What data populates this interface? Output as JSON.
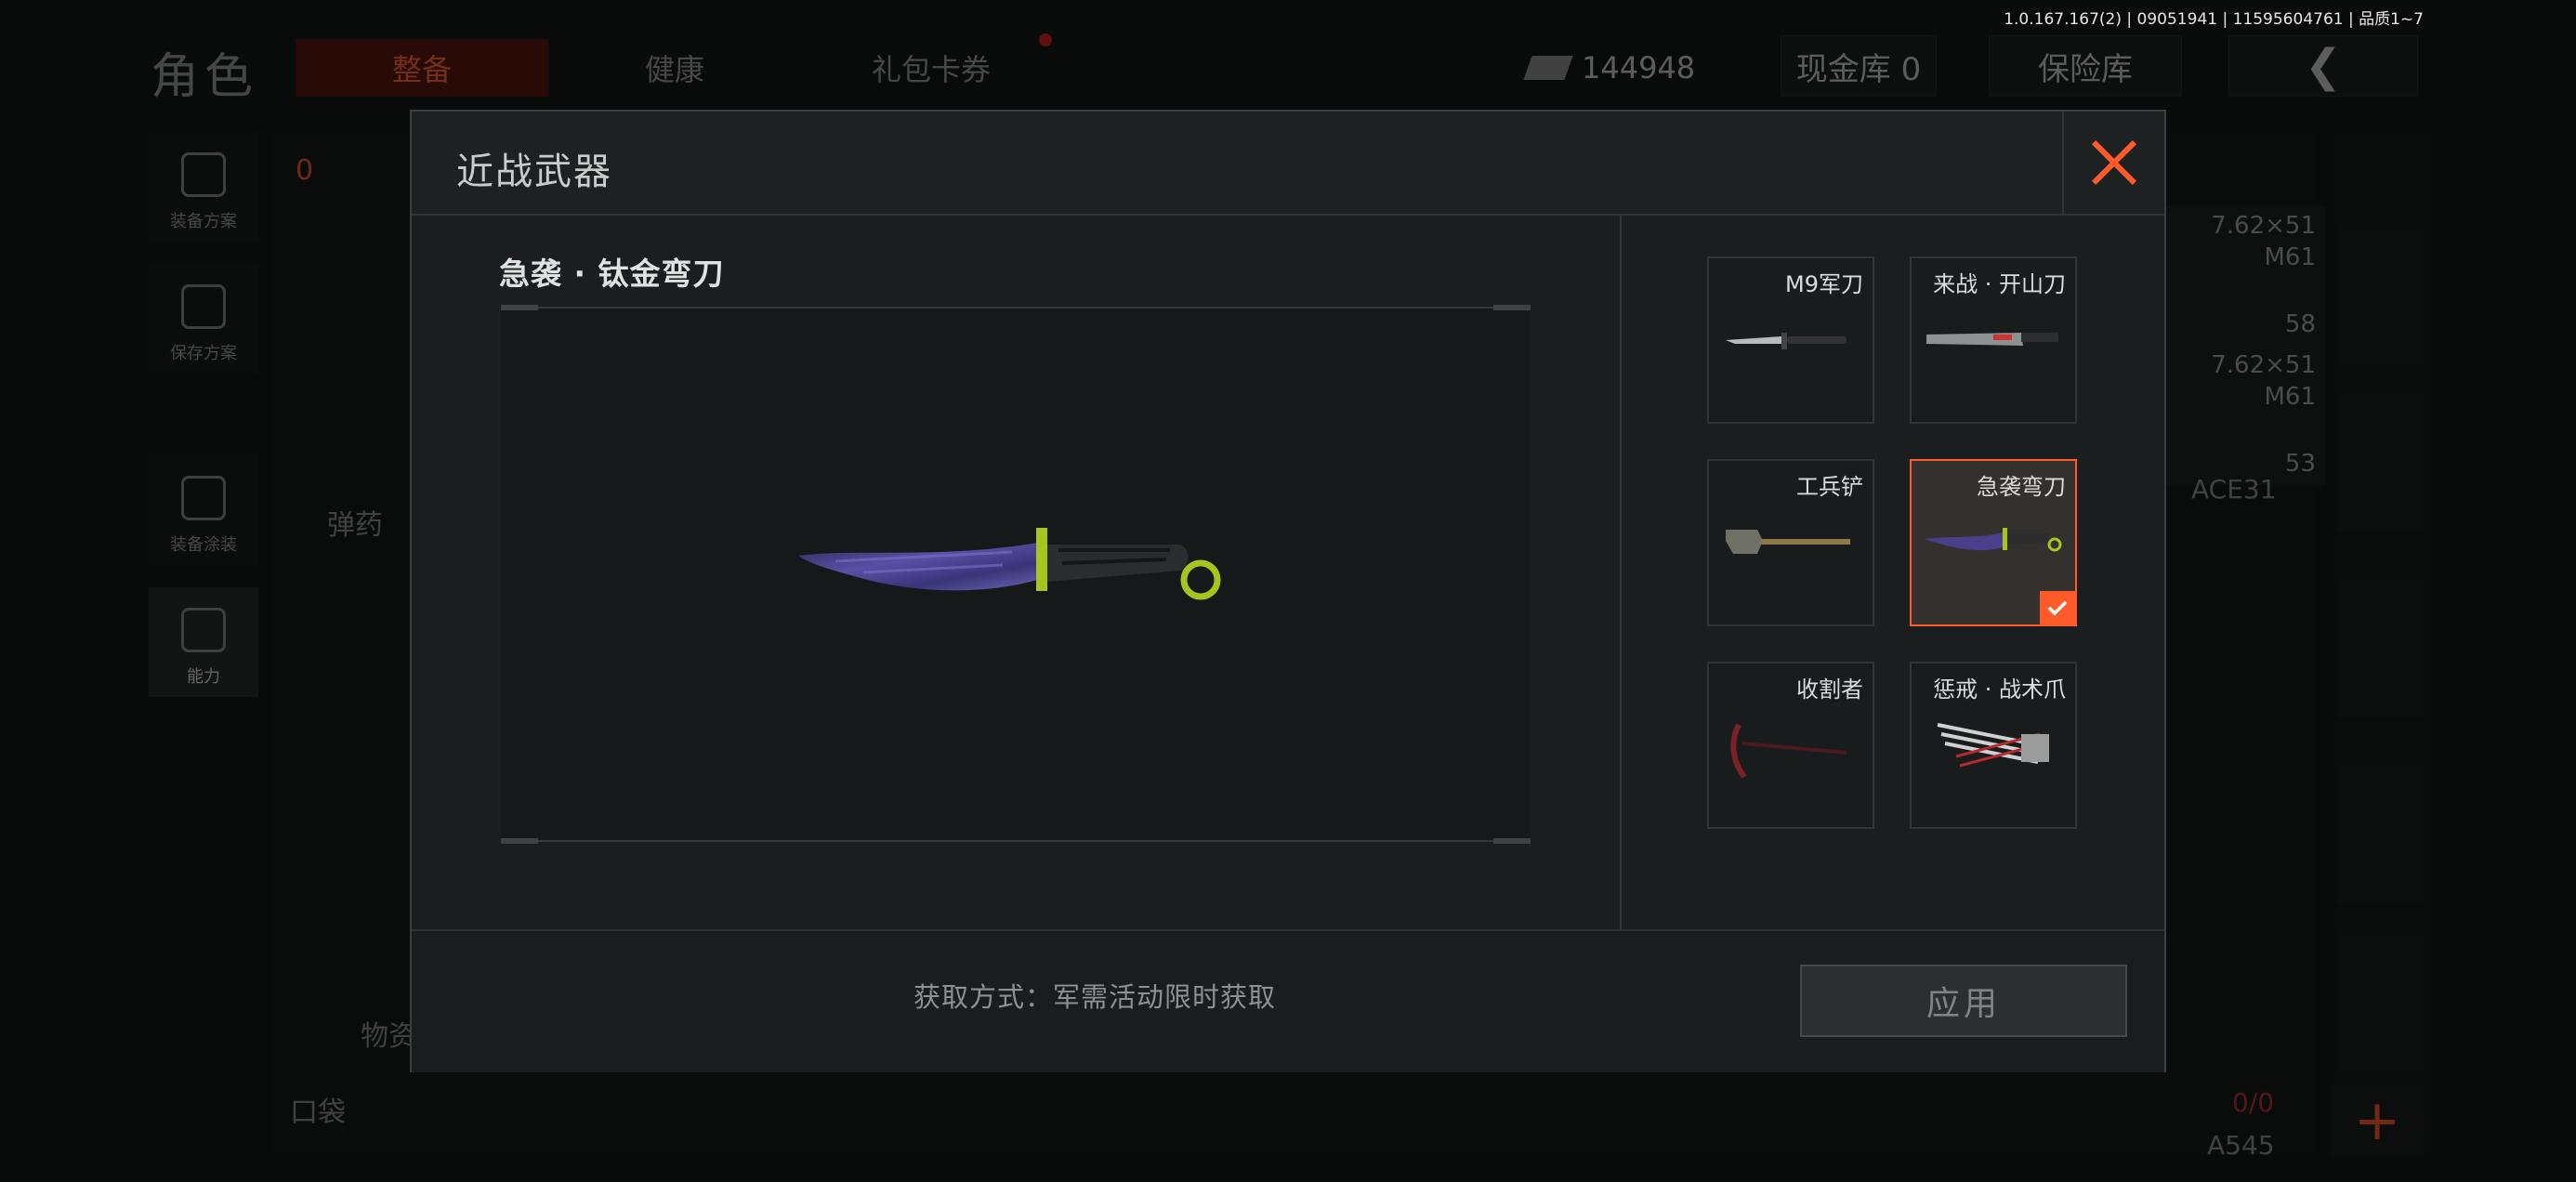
{
  "version": "1.0.167.167(2) | 09051941 | 11595604761 | 品质1~7",
  "background": {
    "title": "角色",
    "tabs": [
      "整备",
      "健康",
      "礼包卡券"
    ],
    "money": "144948",
    "cash_vault": "现金库 0",
    "insurance_vault": "保险库",
    "left_rail": [
      "装备方案",
      "保存方案",
      "装备涂装",
      "能力"
    ],
    "ammo_cards": [
      {
        "caliber": "7.62×51",
        "name": "M61",
        "qty": "58"
      },
      {
        "caliber": "7.62×51",
        "name": "M61",
        "qty": "53"
      }
    ],
    "weapon_name": "ACE31",
    "weapon_name_2": "A545",
    "count": "0/0",
    "ammo_label": "弹药",
    "supplies_label": "物资",
    "pocket_label": "口袋",
    "badge_count": "0"
  },
  "modal": {
    "title": "近战武器",
    "preview_name": "急袭 · 钛金弯刀",
    "acquire_text": "获取方式：军需活动限时获取",
    "apply_label": "应用",
    "weapons": [
      {
        "label": "M9军刀",
        "icon": "bayonet-icon",
        "selected": false
      },
      {
        "label": "来战 · 开山刀",
        "icon": "machete-icon",
        "selected": false
      },
      {
        "label": "工兵铲",
        "icon": "shovel-icon",
        "selected": false
      },
      {
        "label": "急袭弯刀",
        "icon": "karambit-icon",
        "selected": true
      },
      {
        "label": "收割者",
        "icon": "scythe-icon",
        "selected": false
      },
      {
        "label": "惩戒 · 战术爪",
        "icon": "claw-icon",
        "selected": false
      }
    ]
  },
  "colors": {
    "accent": "#ff5a2a",
    "knife_blade": "#4a3f8a",
    "knife_guard": "#a8c41e"
  }
}
